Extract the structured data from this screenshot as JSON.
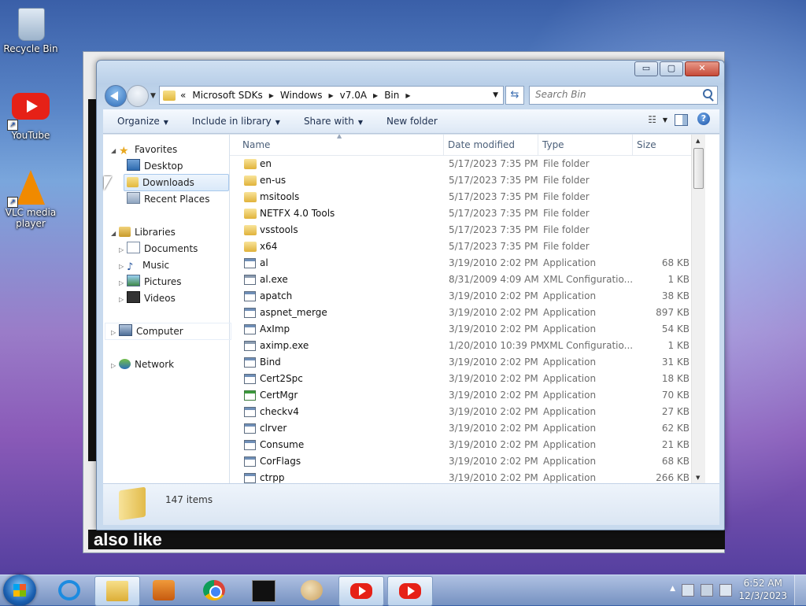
{
  "desktop": {
    "icons": [
      {
        "label": "Recycle Bin",
        "icon": "recycle-bin-icon"
      },
      {
        "label": "YouTube",
        "icon": "youtube-icon"
      },
      {
        "label": "VLC media player",
        "icon": "vlc-icon"
      }
    ],
    "background_caption": "also like"
  },
  "explorer": {
    "window_buttons": {
      "minimize": "▭",
      "maximize": "▢",
      "close": "✕"
    },
    "breadcrumb": {
      "overflow": "«",
      "parts": [
        "Microsoft SDKs",
        "Windows",
        "v7.0A",
        "Bin"
      ]
    },
    "search_placeholder": "Search Bin",
    "toolbar": {
      "organize": "Organize",
      "include_in_library": "Include in library",
      "share_with": "Share with",
      "new_folder": "New folder"
    },
    "nav": {
      "favorites": "Favorites",
      "desktop": "Desktop",
      "downloads": "Downloads",
      "recent_places": "Recent Places",
      "libraries": "Libraries",
      "documents": "Documents",
      "music": "Music",
      "pictures": "Pictures",
      "videos": "Videos",
      "computer": "Computer",
      "network": "Network"
    },
    "columns": {
      "name": "Name",
      "date": "Date modified",
      "type": "Type",
      "size": "Size"
    },
    "files": [
      {
        "name": "en",
        "date": "5/17/2023 7:35 PM",
        "type": "File folder",
        "size": "",
        "kind": "folder"
      },
      {
        "name": "en-us",
        "date": "5/17/2023 7:35 PM",
        "type": "File folder",
        "size": "",
        "kind": "folder"
      },
      {
        "name": "msitools",
        "date": "5/17/2023 7:35 PM",
        "type": "File folder",
        "size": "",
        "kind": "folder"
      },
      {
        "name": "NETFX 4.0 Tools",
        "date": "5/17/2023 7:35 PM",
        "type": "File folder",
        "size": "",
        "kind": "folder"
      },
      {
        "name": "vsstools",
        "date": "5/17/2023 7:35 PM",
        "type": "File folder",
        "size": "",
        "kind": "folder"
      },
      {
        "name": "x64",
        "date": "5/17/2023 7:35 PM",
        "type": "File folder",
        "size": "",
        "kind": "folder"
      },
      {
        "name": "al",
        "date": "3/19/2010 2:02 PM",
        "type": "Application",
        "size": "68 KB",
        "kind": "app"
      },
      {
        "name": "al.exe",
        "date": "8/31/2009 4:09 AM",
        "type": "XML Configuratio...",
        "size": "1 KB",
        "kind": "xml"
      },
      {
        "name": "apatch",
        "date": "3/19/2010 2:02 PM",
        "type": "Application",
        "size": "38 KB",
        "kind": "app"
      },
      {
        "name": "aspnet_merge",
        "date": "3/19/2010 2:02 PM",
        "type": "Application",
        "size": "897 KB",
        "kind": "app"
      },
      {
        "name": "AxImp",
        "date": "3/19/2010 2:02 PM",
        "type": "Application",
        "size": "54 KB",
        "kind": "app"
      },
      {
        "name": "aximp.exe",
        "date": "1/20/2010 10:39 PM",
        "type": "XML Configuratio...",
        "size": "1 KB",
        "kind": "xml"
      },
      {
        "name": "Bind",
        "date": "3/19/2010 2:02 PM",
        "type": "Application",
        "size": "31 KB",
        "kind": "app"
      },
      {
        "name": "Cert2Spc",
        "date": "3/19/2010 2:02 PM",
        "type": "Application",
        "size": "18 KB",
        "kind": "app"
      },
      {
        "name": "CertMgr",
        "date": "3/19/2010 2:02 PM",
        "type": "Application",
        "size": "70 KB",
        "kind": "cert"
      },
      {
        "name": "checkv4",
        "date": "3/19/2010 2:02 PM",
        "type": "Application",
        "size": "27 KB",
        "kind": "app"
      },
      {
        "name": "clrver",
        "date": "3/19/2010 2:02 PM",
        "type": "Application",
        "size": "62 KB",
        "kind": "app"
      },
      {
        "name": "Consume",
        "date": "3/19/2010 2:02 PM",
        "type": "Application",
        "size": "21 KB",
        "kind": "app"
      },
      {
        "name": "CorFlags",
        "date": "3/19/2010 2:02 PM",
        "type": "Application",
        "size": "68 KB",
        "kind": "app"
      },
      {
        "name": "ctrpp",
        "date": "3/19/2010 2:02 PM",
        "type": "Application",
        "size": "266 KB",
        "kind": "app"
      }
    ],
    "status": "147 items"
  },
  "taskbar": {
    "pinned": [
      "internet-explorer-icon",
      "folder-icon",
      "media-icon",
      "chrome-icon",
      "cmd-icon",
      "paint-icon",
      "youtube-icon",
      "youtube-icon"
    ],
    "time": "6:52 AM",
    "date": "12/3/2023"
  }
}
